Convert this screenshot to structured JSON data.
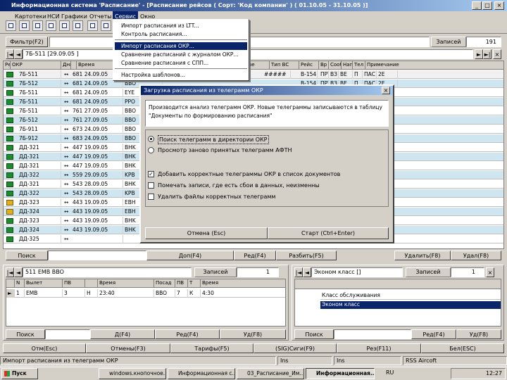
{
  "window": {
    "title": "Информационная система 'Расписание' - [Расписание рейсов ( Сорт: 'Код компании' ) ( 01.10.05 - 31.10.05 )]"
  },
  "menu": [
    "Картотеки",
    "НСИ",
    "Графики",
    "Отчеты",
    "Сервис",
    "Окно"
  ],
  "service_menu": {
    "items": [
      {
        "label": "Импорт расписания из LTT...",
        "highlighted": false
      },
      {
        "label": "Контроль расписания...",
        "highlighted": false
      },
      {
        "label": "Импорт расписания ОКР...",
        "highlighted": true
      },
      {
        "label": "Сравнение расписаний с журналом ОКР...",
        "highlighted": false
      },
      {
        "label": "Сравнение расписания с СПП...",
        "highlighted": false
      },
      {
        "label": "Настройка шаблонов...",
        "highlighted": false
      }
    ]
  },
  "filter": {
    "label": "Фильтр(F2)",
    "records_label": "Записей",
    "records_value": "191"
  },
  "top_search_value": "7Б-511 [29.09.05 ]",
  "main_grid": {
    "headers": [
      "Рейс",
      "ОКР",
      "Дни",
      "",
      "Время",
      "Дни",
      "Время",
      "Дата",
      "Дни",
      "",
      "Ценные",
      "Тип ВС",
      "Рейс",
      "Вр",
      "Сооб",
      "Нап",
      "Тел",
      "Примечание"
    ],
    "rows": [
      {
        "flight": "7Б-511",
        "okr": "681 24.09.05",
        "info": "BBO BKS",
        "selected": true,
        "warn": false
      },
      {
        "flight": "7Б-512",
        "okr": "681 24.09.05",
        "info": "BBO",
        "selected": false,
        "warn": false
      },
      {
        "flight": "7Б-511",
        "okr": "681 24.09.05",
        "info": "EYE",
        "selected": false,
        "warn": false
      },
      {
        "flight": "7Б-511",
        "okr": "681 24.09.05",
        "info": "PPO",
        "selected": false,
        "warn": false
      },
      {
        "flight": "7Б-511",
        "okr": "761 27.09.05",
        "info": "BBO",
        "selected": false,
        "warn": false
      },
      {
        "flight": "7Б-512",
        "okr": "761 27.09.05",
        "info": "BBO",
        "selected": false,
        "warn": false
      },
      {
        "flight": "7Б-911",
        "okr": "673 24.09.05",
        "info": "BBO",
        "selected": false,
        "warn": false
      },
      {
        "flight": "7Б-912",
        "okr": "683 24.09.05",
        "info": "BBO",
        "selected": false,
        "warn": false
      },
      {
        "flight": "ДД-321",
        "okr": "447 19.09.05",
        "info": "BHK",
        "selected": false,
        "warn": false
      },
      {
        "flight": "ДД-321",
        "okr": "447 19.09.05",
        "info": "BHK",
        "selected": false,
        "warn": false
      },
      {
        "flight": "ДД-321",
        "okr": "447 19.09.05",
        "info": "BHK",
        "selected": false,
        "warn": false
      },
      {
        "flight": "ДД-322",
        "okr": "559 29.09.05",
        "info": "KPB",
        "selected": false,
        "warn": false
      },
      {
        "flight": "ДД-321",
        "okr": "543 28.09.05",
        "info": "BHK",
        "selected": false,
        "warn": false
      },
      {
        "flight": "ДД-322",
        "okr": "543 28.09.05",
        "info": "KPB",
        "selected": false,
        "warn": false
      },
      {
        "flight": "ДД-323",
        "okr": "443 19.09.05",
        "info": "EBH",
        "selected": false,
        "warn": true
      },
      {
        "flight": "ДД-324",
        "okr": "443 19.09.05",
        "info": "EBH",
        "selected": false,
        "warn": true
      },
      {
        "flight": "ДД-323",
        "okr": "443 19.09.05",
        "info": "BHK",
        "selected": false,
        "warn": false
      },
      {
        "flight": "ДД-324",
        "okr": "443 19.09.05",
        "info": "BHK",
        "selected": false,
        "warn": false
      },
      {
        "flight": "ДД-325",
        "okr": "",
        "info": "",
        "selected": false,
        "warn": false
      }
    ],
    "first_row_tail": [
      "17.10.05",
      "28.10.05",
      "#####",
      "B-154",
      "ПРТ",
      "ВЗ",
      "ВЕ",
      "П",
      "ПАС",
      "2Е"
    ],
    "second_row_tail": [
      "B-154",
      "ПРТ",
      "ВЗ",
      "ВЕ",
      "П",
      "ПАС",
      "2Е"
    ]
  },
  "main_bottom": {
    "search_label": "Поиск",
    "b1": "Доп(F4)",
    "b2": "Ред(F4)",
    "b3": "Разбить(F5)",
    "b4": "Удалить(F8)",
    "b5": "Удал(F8)"
  },
  "dialog": {
    "title": "Загрузка расписания из телеграмм ОКР",
    "info": "Производится анализ телеграмм ОКР. Новые телеграммы записываются в таблицу \"Документы по формированию расписания\"",
    "radio1": "Поиск телеграмм в директории ОКР",
    "radio2": "Просмотр заново принятых телеграмм АФТН",
    "check1": "Добавить корректные телеграммы ОКР в список документов",
    "check2": "Помечать записи, где есть сбои в данных, неизменны",
    "check3": "Удалить файлы корректных телеграмм",
    "cancel": "Отмена (Esc)",
    "start": "Старт (Ctrl+Enter)"
  },
  "left_panel": {
    "field_value": "511 EMB  BBO",
    "records_label": "Записей",
    "records_value": "1",
    "headers": [
      "N",
      "Вылет",
      "ПВ",
      "",
      "Время",
      "Посад",
      "ПВ",
      "Т",
      "Время"
    ],
    "row": [
      "1",
      "EMB",
      "3",
      "Н",
      "23:40",
      "BBO",
      "7",
      "К",
      "4:30"
    ],
    "search_label": "Поиск",
    "b1": "Д(F4)",
    "b2": "Ред(F4)",
    "b3": "Уд(F8)"
  },
  "right_panel": {
    "field_value": "Эконом класс []",
    "records_label": "Записей",
    "records_value": "1",
    "items": [
      "Класс обслуживания",
      "Эконом класс"
    ],
    "search_label": "Поиск",
    "b1": "Ред(F4)",
    "b2": "Уд(F8)"
  },
  "function_bar": [
    "Отм(Esc)",
    "Отмены(F3)",
    "Тарифы(F5)",
    "(SIG)Сиги(F9)",
    "Рез(F11)",
    "Бел(ESC)"
  ],
  "status_bar": [
    "Импорт расписания из телеграмм ОКР",
    "Ins",
    "Ins",
    "RSS Aircoft"
  ],
  "taskbar": {
    "start": "Пуск",
    "tasks": [
      "windows.кнопочное...",
      "Информационная с...",
      "03_Расписание_Им...",
      "Информационная..."
    ],
    "lang": "RU",
    "clock": "12:27"
  }
}
